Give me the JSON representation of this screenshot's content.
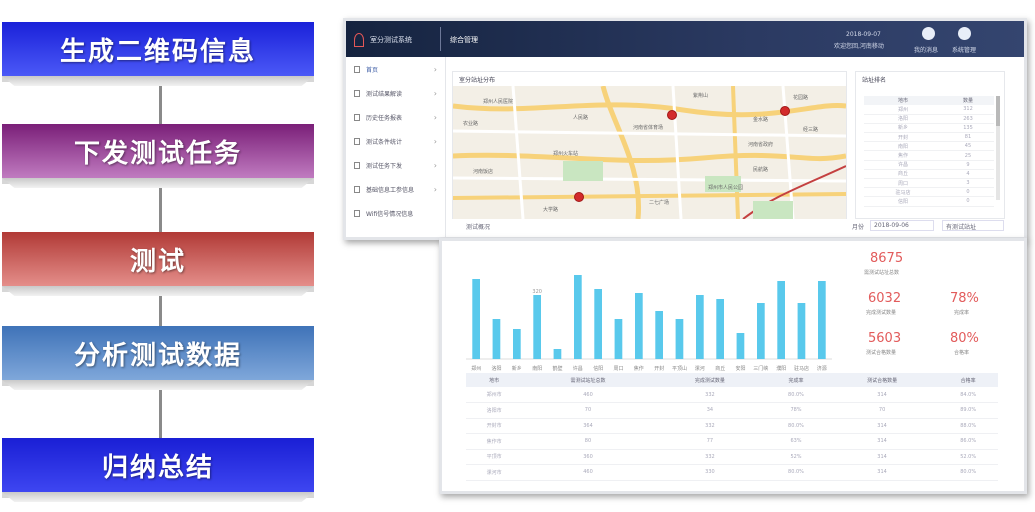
{
  "flow": {
    "steps": [
      "生成二维码信息",
      "下发测试任务",
      "测试",
      "分析测试数据",
      "归纳总结"
    ]
  },
  "app": {
    "system_title": "室分测试系统",
    "nav_tab": "综合管理",
    "date": "2018-09-07",
    "welcome": "欢迎您回,河南移动",
    "top_icons": [
      {
        "icon": "user-icon",
        "label": "我的消息"
      },
      {
        "icon": "gear-icon",
        "label": "系统管理"
      }
    ]
  },
  "sidebar": {
    "items": [
      {
        "label": "首页",
        "icon": "page-icon",
        "active": true
      },
      {
        "label": "测试结果解读",
        "icon": "page-icon"
      },
      {
        "label": "历史任务报表",
        "icon": "page-icon"
      },
      {
        "label": "测试条件统计",
        "icon": "page-icon"
      },
      {
        "label": "测试任务下发",
        "icon": "page-icon"
      },
      {
        "label": "基础信息工参信息",
        "icon": "page-icon"
      },
      {
        "label": "Wifi信号情况信息",
        "icon": "page-icon"
      }
    ]
  },
  "map_panel": {
    "title": "室分站址分布",
    "pois": [
      "郑州人民医院",
      "河南省体育场",
      "郑州市人民公园",
      "河南省政府",
      "二七广场",
      "郑州火车站",
      "金水路",
      "紫荆山",
      "河南饭店",
      "大学路",
      "经三路",
      "花园路",
      "农业路",
      "人民路",
      "民航路"
    ]
  },
  "rank_panel": {
    "title": "站址排名",
    "headers": [
      "地市",
      "数量"
    ],
    "rows": [
      [
        "郑州",
        "312"
      ],
      [
        "洛阳",
        "263"
      ],
      [
        "新乡",
        "135"
      ],
      [
        "开封",
        "81"
      ],
      [
        "南阳",
        "45"
      ],
      [
        "焦作",
        "25"
      ],
      [
        "许昌",
        "9"
      ],
      [
        "商丘",
        "4"
      ],
      [
        "周口",
        "3"
      ],
      [
        "驻马店",
        "0"
      ],
      [
        "信阳",
        "0"
      ]
    ]
  },
  "bottom_strip": {
    "title": "测试概况",
    "month_label": "月份",
    "month_value": "2018-09-06",
    "select_value": "有测试站址"
  },
  "chart_data": {
    "type": "bar",
    "categories": [
      "郑州",
      "洛阳",
      "新乡",
      "南阳",
      "鹤壁",
      "许昌",
      "信阳",
      "周口",
      "焦作",
      "开封",
      "平顶山",
      "漯河",
      "商丘",
      "安阳",
      "三门峡",
      "濮阳",
      "驻马店",
      "济源"
    ],
    "values": [
      400,
      200,
      150,
      320,
      50,
      420,
      350,
      200,
      330,
      240,
      200,
      320,
      300,
      130,
      280,
      390,
      280,
      390
    ],
    "data_labels": [
      "",
      "",
      "",
      "320",
      "",
      "",
      "",
      "",
      "",
      "",
      "",
      "",
      "",
      "",
      "",
      "",
      "",
      ""
    ],
    "color": "#59c9ec",
    "ylim": [
      0,
      460
    ]
  },
  "stats": {
    "kpis": [
      {
        "value": "8675",
        "label": "需测试站址总数"
      },
      {
        "value": "6032",
        "label": "完成测试数量"
      },
      {
        "value": "78%",
        "label": "完成率"
      },
      {
        "value": "5603",
        "label": "测试合格数量"
      },
      {
        "value": "80%",
        "label": "合格率"
      }
    ]
  },
  "result_table": {
    "headers": [
      "地市",
      "需测试站址总数",
      "完成测试数量",
      "完成率",
      "测试合格数量",
      "合格率"
    ],
    "rows": [
      [
        "郑州市",
        "460",
        "332",
        "80.0%",
        "314",
        "84.0%"
      ],
      [
        "洛阳市",
        "70",
        "34",
        "78%",
        "70",
        "89.0%"
      ],
      [
        "开封市",
        "364",
        "332",
        "80.0%",
        "314",
        "88.0%"
      ],
      [
        "焦作市",
        "80",
        "77",
        "63%",
        "314",
        "86.0%"
      ],
      [
        "平顶市",
        "360",
        "332",
        "52%",
        "314",
        "52.0%"
      ],
      [
        "漯河市",
        "460",
        "330",
        "80.0%",
        "314",
        "80.0%"
      ]
    ]
  }
}
